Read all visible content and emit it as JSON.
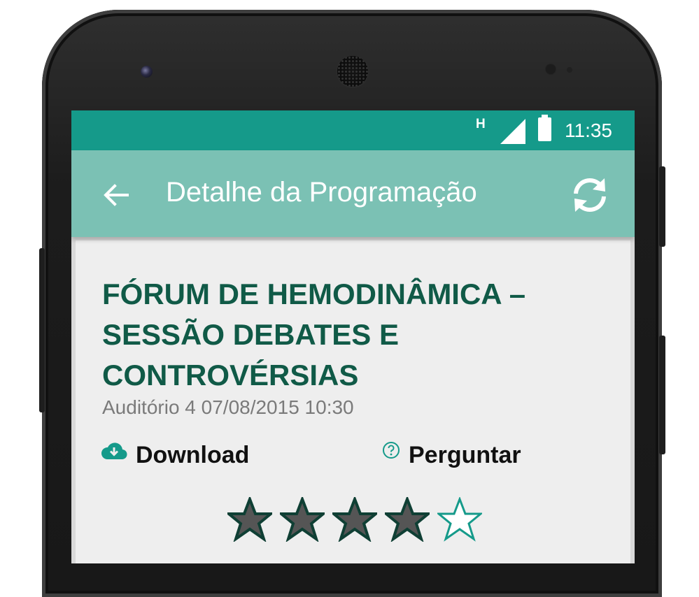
{
  "status_bar": {
    "network_type": "H",
    "time": "11:35",
    "icons": [
      "signal-icon",
      "battery-icon"
    ],
    "color": "#159a8a"
  },
  "app_bar": {
    "title": "Detalhe da Programação",
    "back_icon": "arrow-left-icon",
    "refresh_icon": "refresh-icon",
    "color": "#7bc1b4"
  },
  "event": {
    "title_lines": [
      "FÓRUM DE HEMODINÂMICA –",
      "SESSÃO DEBATES E",
      "CONTROVÉRSIAS"
    ],
    "meta": "Auditório 4 07/08/2015 10:30",
    "title_color": "#105a47"
  },
  "actions": {
    "download_label": "Download",
    "download_icon": "cloud-download-icon",
    "ask_label": "Perguntar",
    "ask_icon": "question-circle-icon",
    "accent_color": "#159a8a"
  },
  "rating": {
    "value": 4,
    "max": 5
  }
}
